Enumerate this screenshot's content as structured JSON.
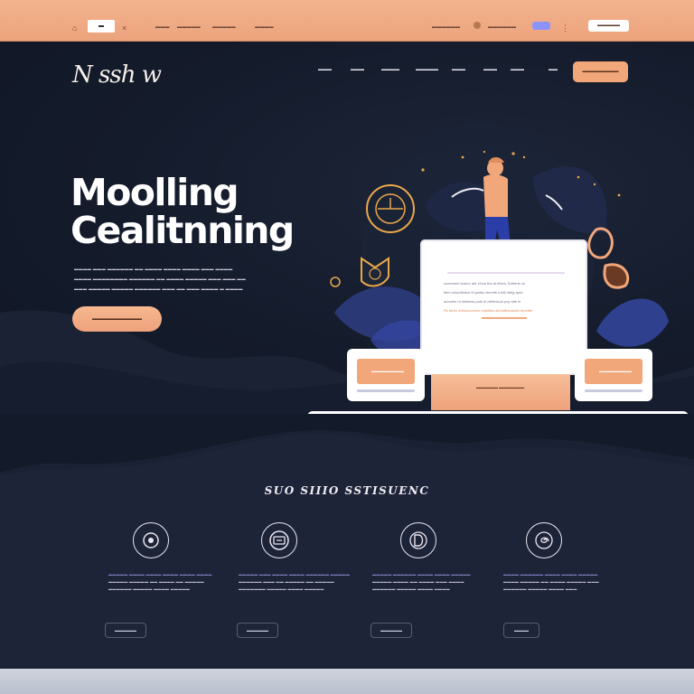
{
  "topbar": {
    "links": [
      "▬▬▬",
      "▬▬▬▬▬",
      "▬▬▬▬▬",
      "▬▬▬▬",
      "▬▬▬▬▬▬",
      "▬▬▬▬▬▬"
    ],
    "button_label": "▬▬▬▬▬"
  },
  "header": {
    "logo_text": "N ssh w",
    "nav": [
      "▬▬▬",
      "▬▬▬",
      "▬▬▬▬",
      "▬▬▬▬▬",
      "▬▬▬",
      "▬▬▬",
      "▬▬▬",
      "▬▬"
    ],
    "cta_label": "▬▬▬▬▬▬▬▬"
  },
  "hero": {
    "title_line1": "Moolling",
    "title_line2": "Cealitnning",
    "lines": [
      "▬▬▬▬ ▬▬▬ ▬▬▬▬▬▬ ▬▬ ▬▬▬▬ ▬▬▬▬ ▬▬▬▬ ▬▬▬ ▬▬▬▬",
      "▬▬▬▬ ▬▬▬▬▬▬▬▬ ▬▬▬▬▬▬ ▬▬ ▬▬▬▬ ▬▬▬▬▬ ▬▬▬ ▬▬▬ ▬▬",
      "▬▬▬ ▬▬▬▬▬ ▬▬▬▬▬ ▬▬▬▬▬▬ ▬▬▬ ▬▬ ▬▬▬ ▬▬▬▬ ▬ ▬▬▬▬"
    ],
    "button_label": "▬▬▬▬▬▬▬▬▬▬▬"
  },
  "illustration": {
    "board_lines": [
      "scoeanerl eotnor ate s'bon the al elhes, Safrerls ce",
      "tlem ooiuufbutcu 6l pusttu foronts ruxl6 ntelg ayrd",
      "aunoilnr ul rsituinss pole ul ofbrtnsuul poy arle le",
      "Rs Mntu ontmuoonnus ontoltlss aionofbsraswin tonettel"
    ],
    "pedestal_label": "▬▬▬▬▬▬ ▬▬▬▬▬▬▬",
    "card_label": "▬▬▬▬▬▬▬▬▬"
  },
  "features": {
    "title": "SUO SIIIO SSTISUENC",
    "items": [
      {
        "icon": "record-icon",
        "lines": [
          "▬▬▬▬▬ ▬▬▬▬ ▬▬▬▬ ▬▬▬▬ ▬▬▬▬ ▬▬▬▬",
          "▬▬▬▬▬ ▬▬▬▬▬ ▬▬ ▬▬▬▬ ▬▬ ▬▬▬▬▬",
          "▬▬▬▬▬▬ ▬▬▬▬▬ ▬▬▬▬ ▬▬▬▬▬"
        ],
        "button": "▬▬▬▬▬▬"
      },
      {
        "icon": "screen-icon",
        "lines": [
          "▬▬▬▬▬ ▬▬▬ ▬▬▬▬ ▬▬▬▬ ▬▬▬▬▬▬ ▬▬▬▬▬",
          "▬▬▬▬▬▬ ▬▬▬ ▬▬ ▬▬▬▬▬ ▬▬ ▬▬▬▬▬",
          "▬▬▬▬▬▬▬ ▬▬▬▬▬ ▬▬▬▬ ▬▬▬▬▬"
        ],
        "button": "▬▬▬▬▬▬"
      },
      {
        "icon": "d-letter-icon",
        "lines": [
          "▬▬▬▬▬ ▬▬▬▬▬▬ ▬▬▬▬ ▬▬▬▬ ▬▬▬▬▬",
          "▬▬▬▬▬ ▬▬▬▬ ▬▬ ▬▬▬▬ ▬▬▬ ▬▬▬▬",
          "▬▬▬▬▬▬ ▬▬▬▬▬ ▬▬▬▬ ▬▬▬▬"
        ],
        "button": "▬▬▬▬▬▬"
      },
      {
        "icon": "swirl-icon",
        "lines": [
          "▬▬▬▬ ▬▬▬▬▬▬ ▬▬▬▬ ▬▬▬▬ ▬▬▬▬▬",
          "▬▬▬▬ ▬▬▬▬▬ ▬▬ ▬▬▬▬ ▬▬▬▬▬ ▬▬▬",
          "▬▬▬▬▬▬ ▬▬▬▬▬ ▬▬▬▬ ▬▬▬"
        ],
        "button": "▬▬▬▬"
      }
    ]
  },
  "colors": {
    "accent_peach": "#f2a77b",
    "hero_bg": "#141b2b",
    "section_bg": "#1a2033",
    "gold_icon": "#e9a84c",
    "link_blue": "#7f86c8"
  }
}
